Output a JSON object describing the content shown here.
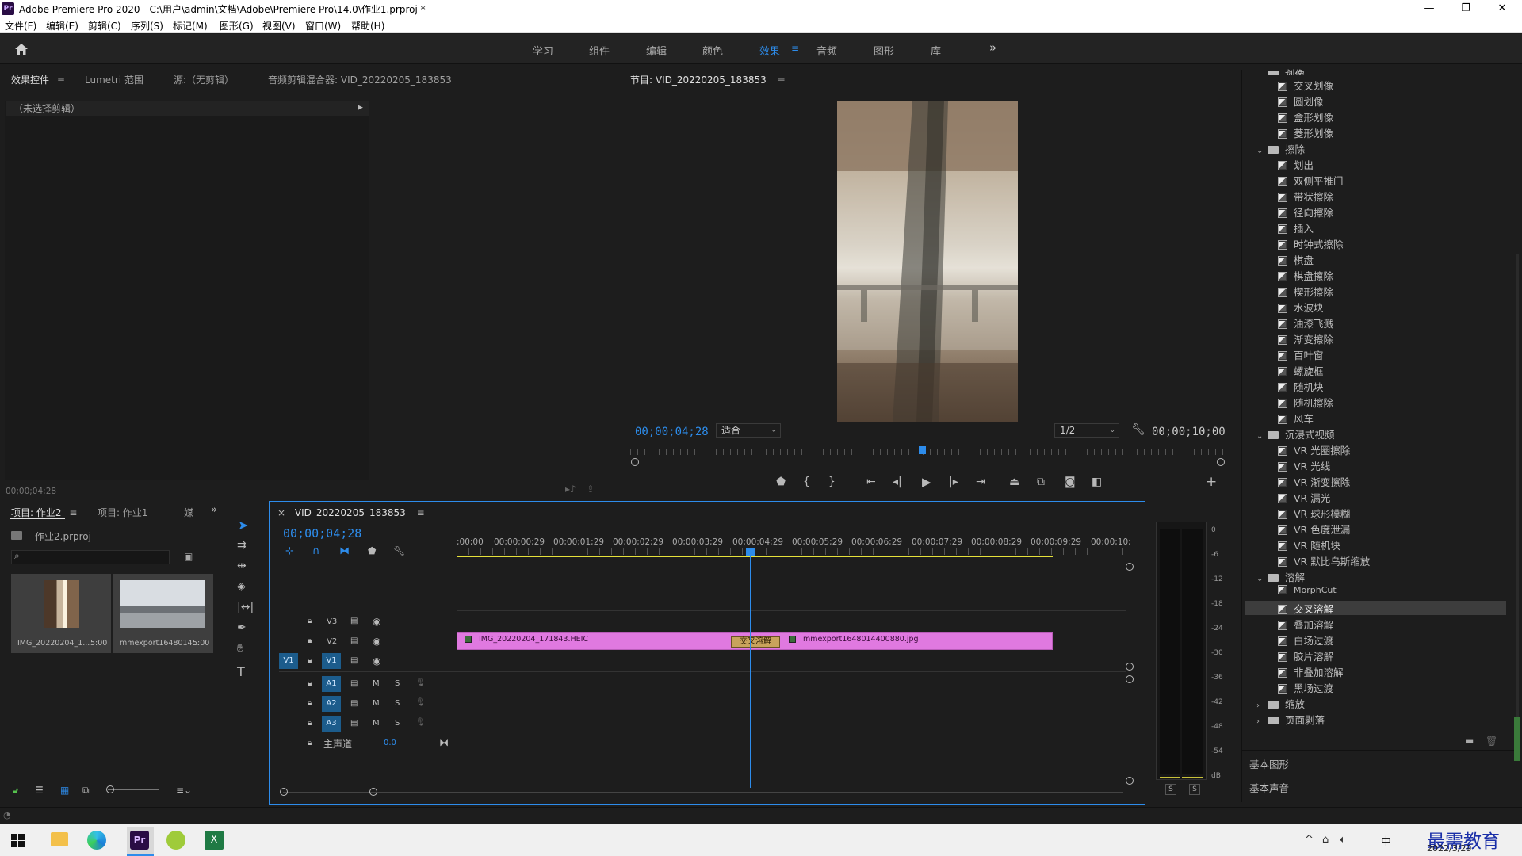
{
  "window": {
    "title": "Adobe Premiere Pro 2020 - C:\\用户\\admin\\文档\\Adobe\\Premiere Pro\\14.0\\作业1.prproj *",
    "logo_text": "Pr",
    "minimize": "—",
    "maximize": "❐",
    "close": "✕"
  },
  "menu": [
    "文件(F)",
    "编辑(E)",
    "剪辑(C)",
    "序列(S)",
    "标记(M)",
    "图形(G)",
    "视图(V)",
    "窗口(W)",
    "帮助(H)"
  ],
  "workspaces": {
    "items": [
      "学习",
      "组件",
      "编辑",
      "颜色",
      "效果",
      "音频",
      "图形",
      "库"
    ],
    "active": "效果",
    "more": "»"
  },
  "source_panel": {
    "tabs": [
      "效果控件",
      "Lumetri 范围",
      "源:（无剪辑）",
      "音频剪辑混合器: VID_20220205_183853"
    ],
    "no_clip": "（未选择剪辑）",
    "timecode": "00;00;04;28"
  },
  "program_monitor": {
    "title": "节目: VID_20220205_183853",
    "timecode": "00;00;04;28",
    "fit": "适合",
    "resolution": "1/2",
    "duration": "00;00;10;00"
  },
  "project_panel": {
    "tabs": [
      "项目: 作业2",
      "项目: 作业1",
      "媒"
    ],
    "file": "作业2.prproj",
    "items": [
      {
        "name": "IMG_20220204_1...",
        "duration": "5:00"
      },
      {
        "name": "mmexport1648014...",
        "duration": "5:00"
      }
    ]
  },
  "timeline": {
    "sequence": "VID_20220205_183853",
    "timecode": "00;00;04;28",
    "ruler": [
      ";00;00",
      "00;00;00;29",
      "00;00;01;29",
      "00;00;02;29",
      "00;00;03;29",
      "00;00;04;29",
      "00;00;05;29",
      "00;00;06;29",
      "00;00;07;29",
      "00;00;08;29",
      "00;00;09;29",
      "00;00;10;"
    ],
    "video_tracks": [
      "V3",
      "V2",
      "V1"
    ],
    "audio_tracks": [
      "A1",
      "A2",
      "A3"
    ],
    "master_label": "主声道",
    "master_value": "0.0",
    "source_patch": "V1",
    "clip1": "IMG_20220204_171843.HEIC",
    "clip2": "mmexport1648014400880.jpg",
    "transition": "交叉溶解",
    "m": "M",
    "s": "S"
  },
  "meter": {
    "labels": [
      "0",
      "-6",
      "-12",
      "-18",
      "-24",
      "-30",
      "-36",
      "-42",
      "-48",
      "-54",
      "dB"
    ],
    "solo": [
      "S",
      "S"
    ]
  },
  "effects": {
    "top_partial": "划像",
    "group1": [
      "交叉划像",
      "圆划像",
      "盒形划像",
      "菱形划像"
    ],
    "folder_wipe": "擦除",
    "wipe_items": [
      "划出",
      "双侧平推门",
      "带状擦除",
      "径向擦除",
      "插入",
      "时钟式擦除",
      "棋盘",
      "棋盘擦除",
      "楔形擦除",
      "水波块",
      "油漆飞溅",
      "渐变擦除",
      "百叶窗",
      "螺旋框",
      "随机块",
      "随机擦除",
      "风车"
    ],
    "folder_immersive": "沉浸式视频",
    "immersive_items": [
      "VR 光圈擦除",
      "VR 光线",
      "VR 渐变擦除",
      "VR 漏光",
      "VR 球形模糊",
      "VR 色度泄漏",
      "VR 随机块",
      "VR 默比乌斯缩放"
    ],
    "folder_dissolve": "溶解",
    "dissolve_items": [
      "MorphCut",
      "交叉溶解",
      "叠加溶解",
      "白场过渡",
      "胶片溶解",
      "非叠加溶解",
      "黑场过渡"
    ],
    "folder_zoom": "缩放",
    "folder_page": "页面剥落",
    "basic_graphics": "基本图形",
    "basic_sound": "基本声音",
    "selected": "交叉溶解"
  },
  "taskbar": {
    "date": "2022/3/29",
    "ime": "中",
    "watermark": "最需教育"
  },
  "colors": {
    "accent": "#2d8ceb",
    "clip": "#e079e0",
    "workarea": "#e6e13a"
  }
}
